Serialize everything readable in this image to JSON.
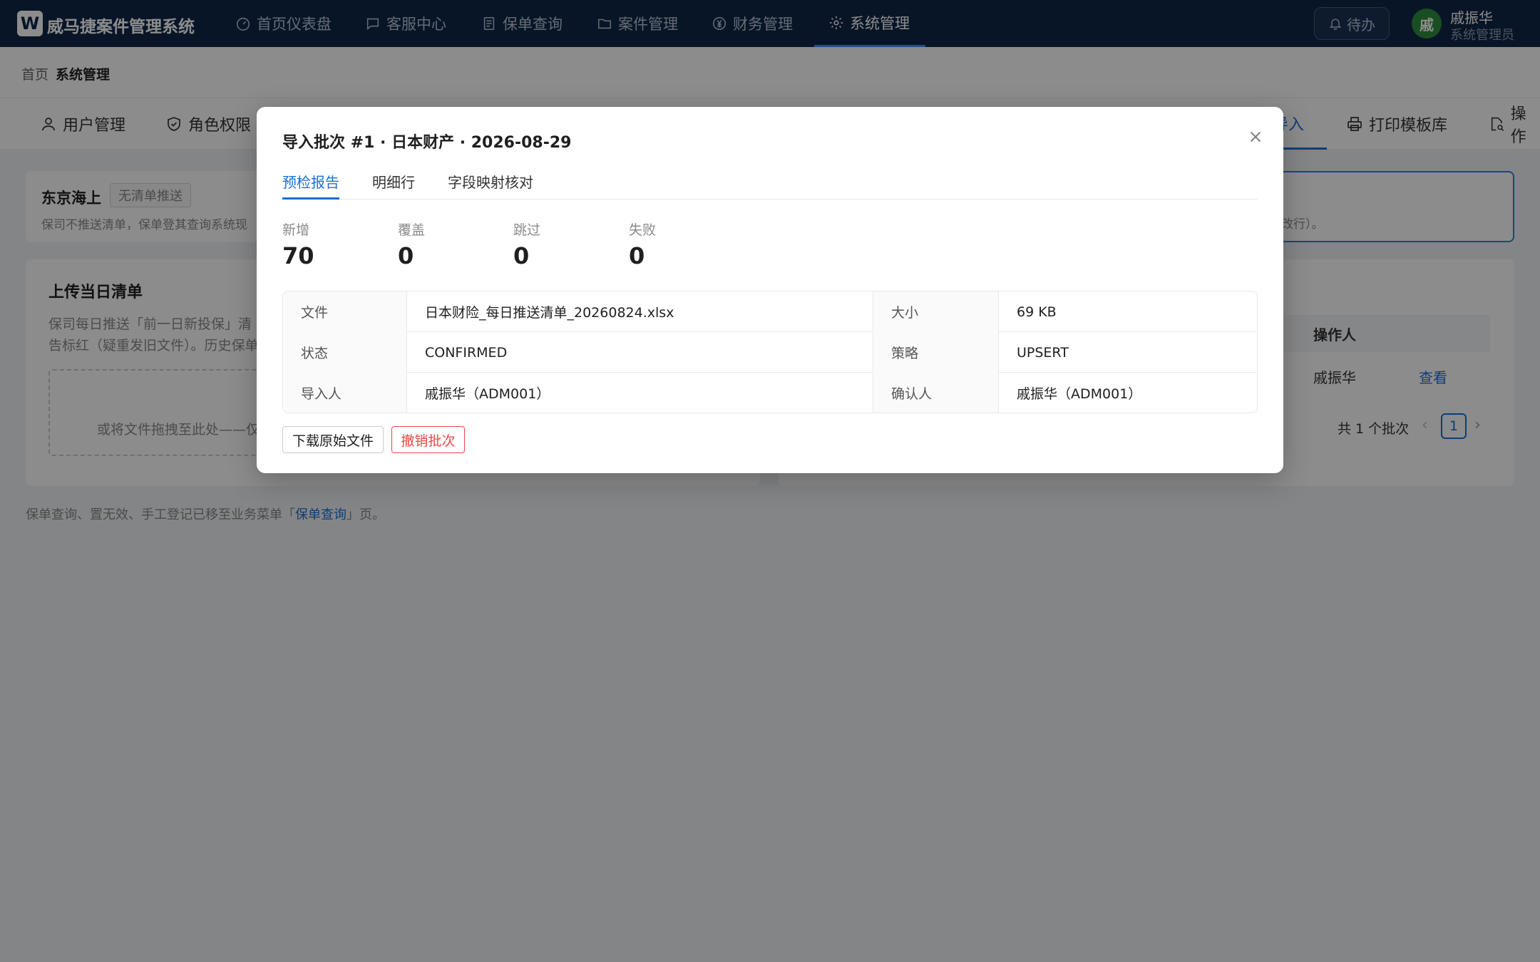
{
  "app": {
    "logo_letter": "W",
    "title": "威马捷案件管理系统"
  },
  "nav": {
    "items": [
      {
        "label": "首页仪表盘",
        "icon": "dashboard-icon"
      },
      {
        "label": "客服中心",
        "icon": "chat-icon"
      },
      {
        "label": "保单查询",
        "icon": "document-icon"
      },
      {
        "label": "案件管理",
        "icon": "folder-icon"
      },
      {
        "label": "财务管理",
        "icon": "yen-icon"
      },
      {
        "label": "系统管理",
        "icon": "gear-icon",
        "active": true
      }
    ],
    "todo_label": "待办",
    "user": {
      "avatar_char": "戚",
      "name": "戚振华",
      "role": "系统管理员"
    }
  },
  "breadcrumb": {
    "home": "首页",
    "current": "系统管理"
  },
  "subtabs": {
    "user_mgmt": "用户管理",
    "role_perm": "角色权限",
    "import_partial": "导入",
    "print_templates": "打印模板库",
    "ops_partial": "操作"
  },
  "background": {
    "company_name": "东京海上",
    "company_tag": "无清单推送",
    "company_desc": "保司不推送清单，保单登其查询系统现",
    "banner_tail": "改行）。",
    "upload_title": "上传当日清单",
    "upload_desc_line1": "保司每日推送「前一日新投保」清",
    "upload_desc_line2": "告标红（疑重发旧文件）。历史保单",
    "dropzone_text": "或将文件拖拽至此处——仅",
    "table_header_operator": "操作人",
    "table_row_operator": "戚振华",
    "table_row_action": "查看",
    "pager_total": "共 1 个批次",
    "pager_prev": "‹",
    "pager_page": "1",
    "pager_next": "›",
    "footnote_pre": "保单查询、置无效、手工登记已移至业务菜单「",
    "footnote_link": "保单查询",
    "footnote_post": "」页。"
  },
  "modal": {
    "title": "导入批次 #1 · 日本财产 · 2026-08-29",
    "tabs": [
      "预检报告",
      "明细行",
      "字段映射核对"
    ],
    "active_tab": 0,
    "stats": [
      {
        "label": "新增",
        "value": "70"
      },
      {
        "label": "覆盖",
        "value": "0"
      },
      {
        "label": "跳过",
        "value": "0"
      },
      {
        "label": "失败",
        "value": "0"
      }
    ],
    "details": [
      {
        "label1": "文件",
        "value1": "日本财险_每日推送清单_20260824.xlsx",
        "label2": "大小",
        "value2": "69 KB"
      },
      {
        "label1": "状态",
        "value1": "CONFIRMED",
        "label2": "策略",
        "value2": "UPSERT"
      },
      {
        "label1": "导入人",
        "value1": "戚振华（ADM001）",
        "label2": "确认人",
        "value2": "戚振华（ADM001）"
      }
    ],
    "download_button": "下载原始文件",
    "revoke_button": "撤销批次"
  }
}
